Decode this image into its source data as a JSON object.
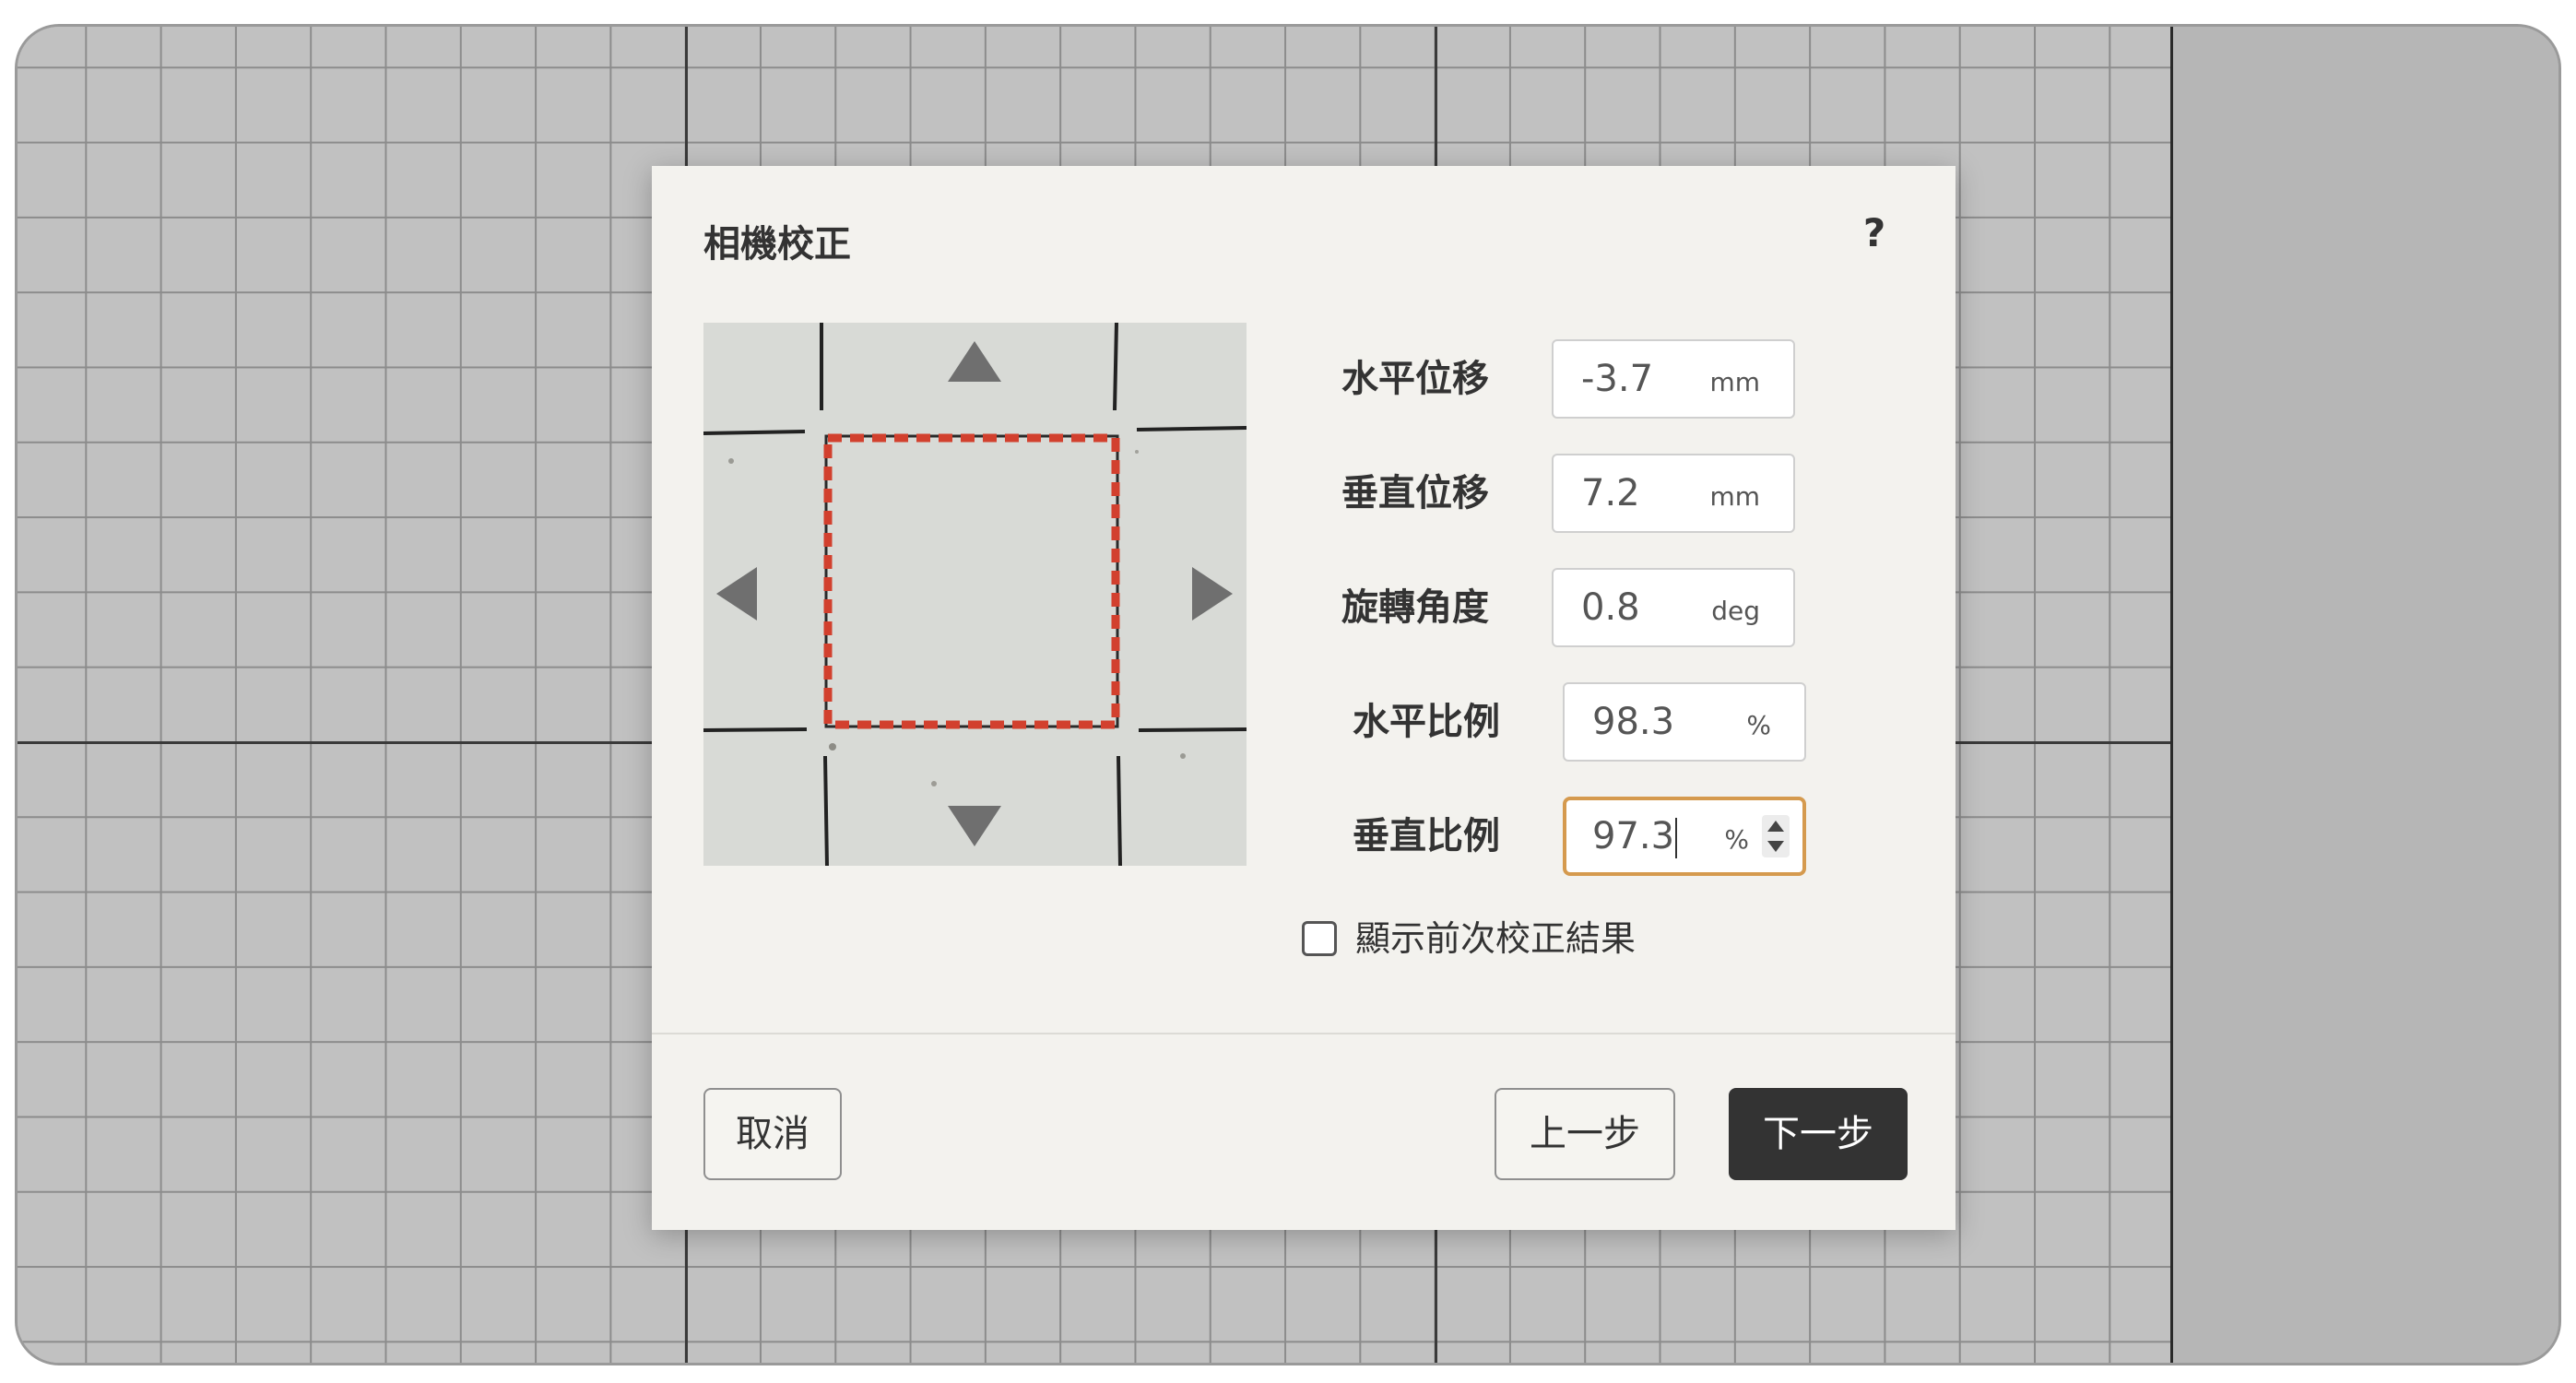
{
  "dialog": {
    "title": "相機校正",
    "help_icon_glyph": "?",
    "fields": [
      {
        "label": "水平位移",
        "value": "-3.7",
        "unit": "mm"
      },
      {
        "label": "垂直位移",
        "value": "7.2",
        "unit": "mm"
      },
      {
        "label": "旋轉角度",
        "value": "0.8",
        "unit": "deg"
      },
      {
        "label": "水平比例",
        "value": "98.3",
        "unit": "%"
      },
      {
        "label": "垂直比例",
        "value": "97.3",
        "unit": "%"
      }
    ],
    "show_previous_checkbox": {
      "label": "顯示前次校正結果",
      "checked": false
    },
    "buttons": {
      "cancel": "取消",
      "previous": "上一步",
      "next": "下一步"
    }
  },
  "icons": {
    "help": "question-mark-icon",
    "arrow_up": "triangle-up-icon",
    "arrow_down": "triangle-down-icon",
    "arrow_left": "triangle-left-icon",
    "arrow_right": "triangle-right-icon",
    "stepper": "spin-stepper-icon"
  },
  "colors": {
    "primary_button": "#333333",
    "focus_border": "#d59a4e",
    "calibration_box": "#d2402e",
    "dialog_background": "#f3f2ee"
  }
}
